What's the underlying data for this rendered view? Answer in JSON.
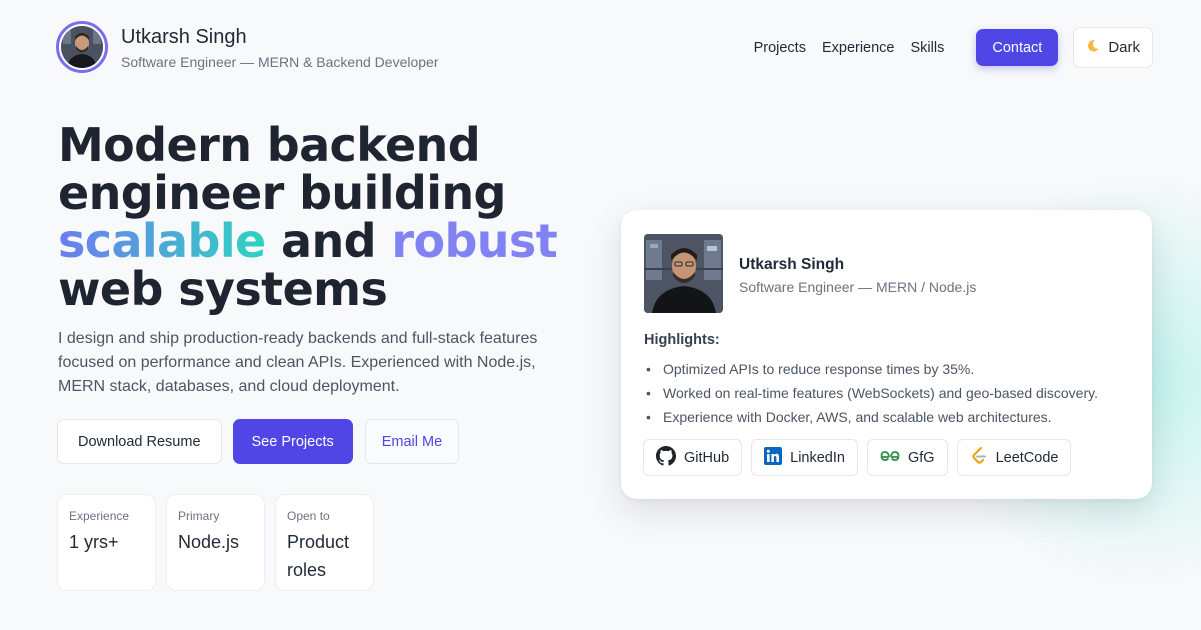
{
  "header": {
    "name": "Utkarsh Singh",
    "subtitle": "Software Engineer — MERN & Backend Developer",
    "nav": [
      {
        "label": "Projects"
      },
      {
        "label": "Experience"
      },
      {
        "label": "Skills"
      }
    ],
    "contact_label": "Contact",
    "theme_toggle_label": "Dark",
    "theme_icon": "moon-icon"
  },
  "hero": {
    "line1": "Modern backend",
    "line2": "engineer building",
    "highlight1": "scalable",
    "mid": "and",
    "highlight2": "robust",
    "line4": "web systems",
    "description": "I design and ship production-ready backends and full-stack features focused on performance and clean APIs. Experienced with Node.js, MERN stack, databases, and cloud deployment.",
    "buttons": {
      "download": "Download Resume",
      "projects": "See Projects",
      "email": "Email Me"
    },
    "stats": [
      {
        "label": "Experience",
        "value": "1 yrs+"
      },
      {
        "label": "Primary",
        "value": "Node.js"
      },
      {
        "label": "Open to",
        "value": "Product roles"
      }
    ]
  },
  "card": {
    "name": "Utkarsh Singh",
    "role": "Software Engineer — MERN / Node.js",
    "highlights_title": "Highlights:",
    "highlights": [
      "Optimized APIs to reduce response times by 35%.",
      "Worked on real-time features (WebSockets) and geo-based discovery.",
      "Experience with Docker, AWS, and scalable web architectures."
    ],
    "links": [
      {
        "label": "GitHub",
        "icon": "github-icon"
      },
      {
        "label": "LinkedIn",
        "icon": "linkedin-icon"
      },
      {
        "label": "GfG",
        "icon": "gfg-icon"
      },
      {
        "label": "LeetCode",
        "icon": "leetcode-icon"
      }
    ]
  },
  "colors": {
    "accent": "#4f46e5",
    "gradient_start": "#6d7cf0",
    "gradient_end": "#2dd4bf",
    "highlight_purple": "#8183f2"
  }
}
